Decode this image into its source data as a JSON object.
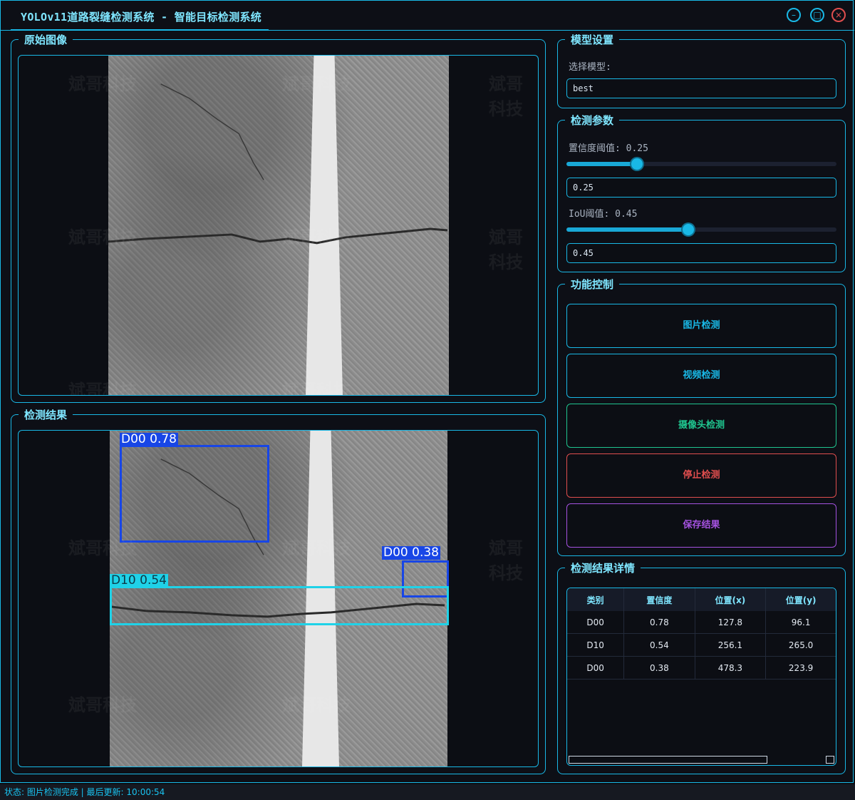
{
  "window": {
    "title": "YOLOv11道路裂缝检测系统 - 智能目标检测系统",
    "minimize_symbol": "–",
    "maximize_symbol": "□",
    "close_symbol": "×"
  },
  "watermark_text": "斌哥科技",
  "panels": {
    "original": {
      "title": "原始图像"
    },
    "result": {
      "title": "检测结果"
    }
  },
  "detections": [
    {
      "label": "D00 0.78",
      "color": "#1846e6"
    },
    {
      "label": "D00 0.38",
      "color": "#1846e6"
    },
    {
      "label": "D10 0.54",
      "color": "#1fd2e8"
    }
  ],
  "model_settings": {
    "title": "模型设置",
    "select_label": "选择模型:",
    "selected_model": "best"
  },
  "detection_params": {
    "title": "检测参数",
    "confidence_label": "置信度阈值: 0.25",
    "confidence_value": "0.25",
    "confidence_level": 0.25,
    "iou_label": "IoU阈值: 0.45",
    "iou_value": "0.45",
    "iou_level": 0.45
  },
  "controls": {
    "title": "功能控制",
    "buttons": [
      {
        "label": "图片检测",
        "color": "#19b8e6"
      },
      {
        "label": "视频检测",
        "color": "#19b8e6"
      },
      {
        "label": "摄像头检测",
        "color": "#1fc58f"
      },
      {
        "label": "停止检测",
        "color": "#e04e4e"
      },
      {
        "label": "保存结果",
        "color": "#a552e0"
      }
    ]
  },
  "results_table": {
    "title": "检测结果详情",
    "headers": [
      "类别",
      "置信度",
      "位置(x)",
      "位置(y)"
    ],
    "rows": [
      [
        "D00",
        "0.78",
        "127.8",
        "96.1"
      ],
      [
        "D10",
        "0.54",
        "256.1",
        "265.0"
      ],
      [
        "D00",
        "0.38",
        "478.3",
        "223.9"
      ]
    ]
  },
  "status_bar": "状态: 图片检测完成 | 最后更新: 10:00:54"
}
